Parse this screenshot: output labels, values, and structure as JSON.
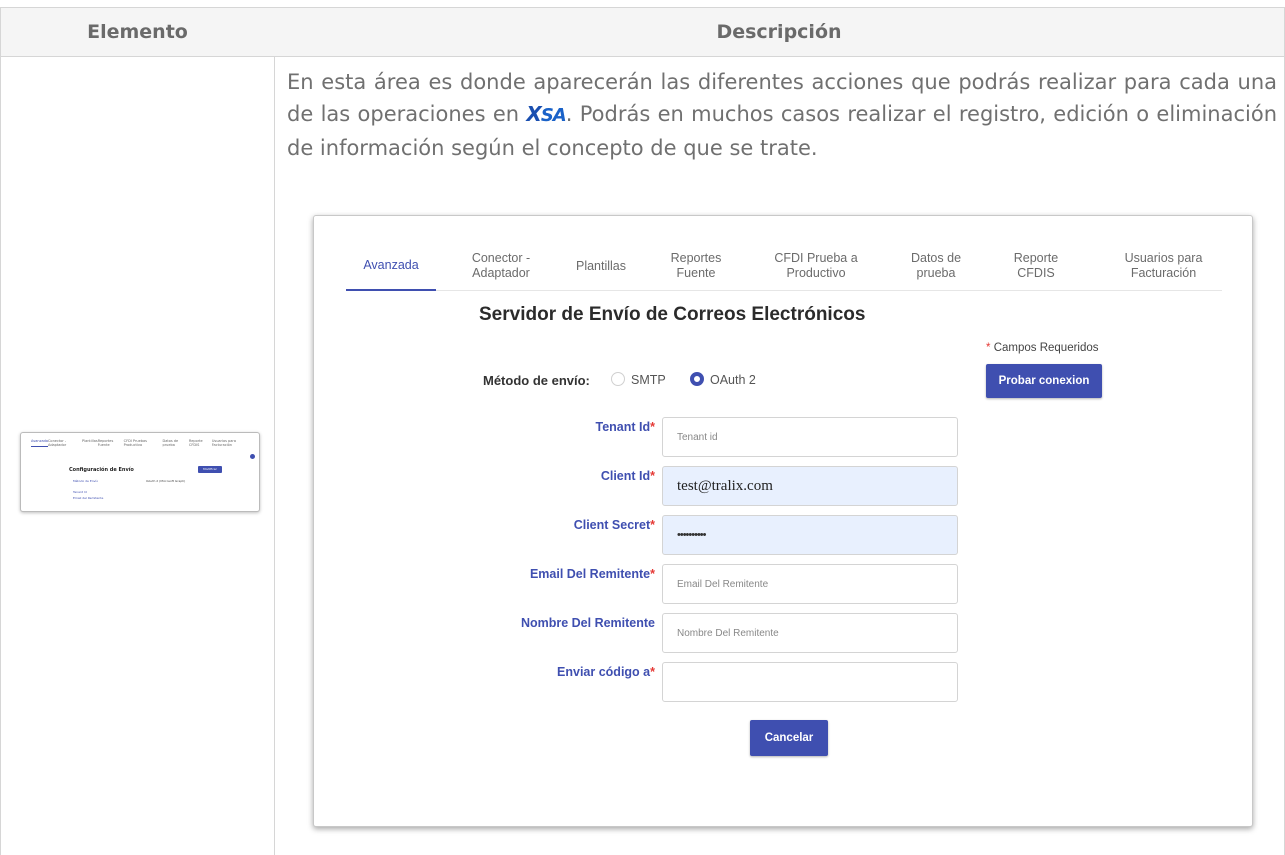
{
  "table": {
    "col_elemento": "Elemento",
    "col_descripcion": "Descripción"
  },
  "description": {
    "part1": "En esta área es donde aparecerán las diferentes acciones que podrás realizar para cada una de las operaciones en ",
    "logo": "XSA",
    "part2": ". Podrás en muchos casos realizar el registro, edición o eliminación de información según el concepto de que se trate."
  },
  "thumbnail": {
    "tabs": [
      "Avanzada",
      "Conector - Adaptador",
      "Plantillas",
      "Reportes Fuente",
      "CFDI Pruebas Productivo",
      "Datos de prueba",
      "Reporte CFDIS",
      "Usuarios para Facturación"
    ],
    "title": "Configuración de Envío",
    "button": "Modificar",
    "rows": [
      {
        "label": "Método de Envío",
        "value": "OAuth 2 (Microsoft Graph)"
      },
      {
        "label": "Tenant Id",
        "value": ""
      },
      {
        "label": "Email del Remitente",
        "value": ""
      }
    ]
  },
  "screenshot": {
    "tabs": [
      {
        "label": "Avanzada",
        "active": true
      },
      {
        "label": "Conector - Adaptador",
        "active": false
      },
      {
        "label": "Plantillas",
        "active": false
      },
      {
        "label": "Reportes Fuente",
        "active": false
      },
      {
        "label": "CFDI Prueba a Productivo",
        "active": false
      },
      {
        "label": "Datos de prueba",
        "active": false
      },
      {
        "label": "Reporte CFDIS",
        "active": false
      },
      {
        "label": "Usuarios para Facturación",
        "active": false
      }
    ],
    "title": "Servidor de Envío de Correos Electrónicos",
    "required_note": "Campos Requeridos",
    "test_button": "Probar conexion",
    "metodo_label": "Método de envío:",
    "radio_smtp": "SMTP",
    "radio_oauth": "OAuth 2",
    "selected_method": "OAuth 2",
    "fields": {
      "tenant_label": "Tenant Id",
      "tenant_placeholder": "Tenant id",
      "client_id_label": "Client Id",
      "client_id_value": "test@tralix.com",
      "client_secret_label": "Client Secret",
      "client_secret_value": "••••••••••",
      "email_label": "Email Del Remitente",
      "email_placeholder": "Email Del Remitente",
      "nombre_label": "Nombre Del Remitente",
      "nombre_placeholder": "Nombre Del Remitente",
      "codigo_label": "Enviar código a",
      "codigo_placeholder": ""
    },
    "cancel_button": "Cancelar"
  },
  "colors": {
    "accent": "#3f4fb0",
    "required_star": "#e53935",
    "autofill": "#e8f0fe"
  }
}
